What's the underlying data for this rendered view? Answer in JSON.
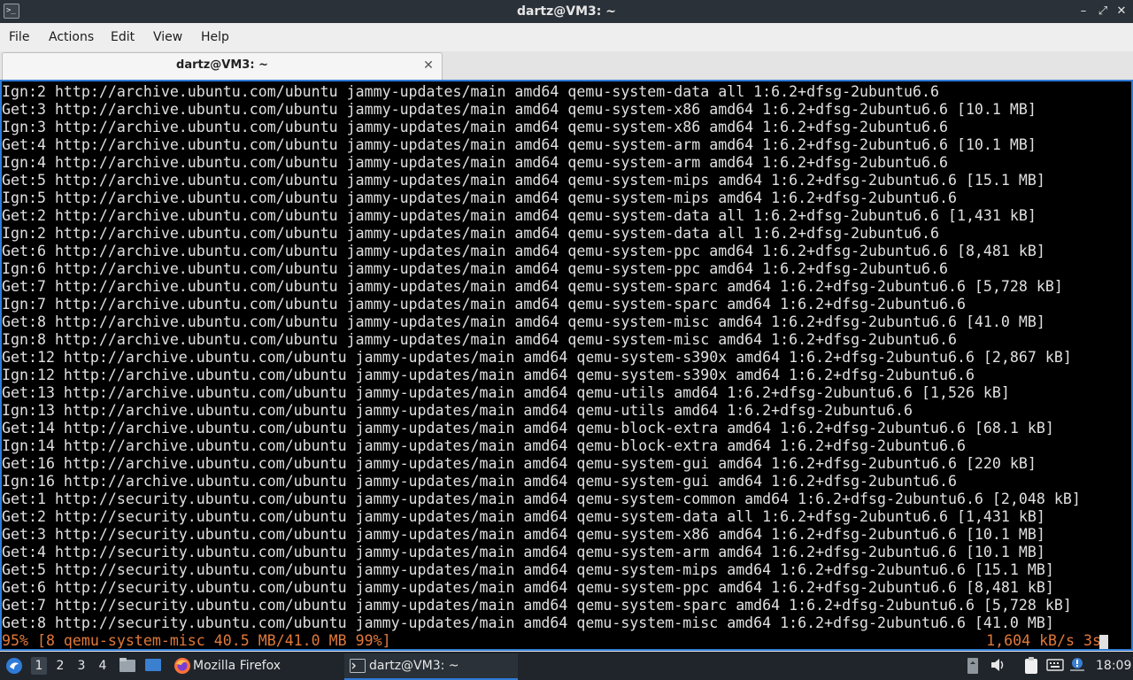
{
  "window": {
    "title": "dartz@VM3: ~",
    "app_icon_glyph": ">_",
    "controls": {
      "minimize": "–",
      "maximize": "⤢",
      "close": "✕"
    }
  },
  "menu": {
    "items": [
      "File",
      "Actions",
      "Edit",
      "View",
      "Help"
    ]
  },
  "tab": {
    "label": "dartz@VM3: ~",
    "close_glyph": "✕"
  },
  "terminal": {
    "lines": [
      "Ign:2 http://archive.ubuntu.com/ubuntu jammy-updates/main amd64 qemu-system-data all 1:6.2+dfsg-2ubuntu6.6",
      "Get:3 http://archive.ubuntu.com/ubuntu jammy-updates/main amd64 qemu-system-x86 amd64 1:6.2+dfsg-2ubuntu6.6 [10.1 MB]",
      "Ign:3 http://archive.ubuntu.com/ubuntu jammy-updates/main amd64 qemu-system-x86 amd64 1:6.2+dfsg-2ubuntu6.6",
      "Get:4 http://archive.ubuntu.com/ubuntu jammy-updates/main amd64 qemu-system-arm amd64 1:6.2+dfsg-2ubuntu6.6 [10.1 MB]",
      "Ign:4 http://archive.ubuntu.com/ubuntu jammy-updates/main amd64 qemu-system-arm amd64 1:6.2+dfsg-2ubuntu6.6",
      "Get:5 http://archive.ubuntu.com/ubuntu jammy-updates/main amd64 qemu-system-mips amd64 1:6.2+dfsg-2ubuntu6.6 [15.1 MB]",
      "Ign:5 http://archive.ubuntu.com/ubuntu jammy-updates/main amd64 qemu-system-mips amd64 1:6.2+dfsg-2ubuntu6.6",
      "Get:2 http://archive.ubuntu.com/ubuntu jammy-updates/main amd64 qemu-system-data all 1:6.2+dfsg-2ubuntu6.6 [1,431 kB]",
      "Ign:2 http://archive.ubuntu.com/ubuntu jammy-updates/main amd64 qemu-system-data all 1:6.2+dfsg-2ubuntu6.6",
      "Get:6 http://archive.ubuntu.com/ubuntu jammy-updates/main amd64 qemu-system-ppc amd64 1:6.2+dfsg-2ubuntu6.6 [8,481 kB]",
      "Ign:6 http://archive.ubuntu.com/ubuntu jammy-updates/main amd64 qemu-system-ppc amd64 1:6.2+dfsg-2ubuntu6.6",
      "Get:7 http://archive.ubuntu.com/ubuntu jammy-updates/main amd64 qemu-system-sparc amd64 1:6.2+dfsg-2ubuntu6.6 [5,728 kB]",
      "Ign:7 http://archive.ubuntu.com/ubuntu jammy-updates/main amd64 qemu-system-sparc amd64 1:6.2+dfsg-2ubuntu6.6",
      "Get:8 http://archive.ubuntu.com/ubuntu jammy-updates/main amd64 qemu-system-misc amd64 1:6.2+dfsg-2ubuntu6.6 [41.0 MB]",
      "Ign:8 http://archive.ubuntu.com/ubuntu jammy-updates/main amd64 qemu-system-misc amd64 1:6.2+dfsg-2ubuntu6.6",
      "Get:12 http://archive.ubuntu.com/ubuntu jammy-updates/main amd64 qemu-system-s390x amd64 1:6.2+dfsg-2ubuntu6.6 [2,867 kB]",
      "Ign:12 http://archive.ubuntu.com/ubuntu jammy-updates/main amd64 qemu-system-s390x amd64 1:6.2+dfsg-2ubuntu6.6",
      "Get:13 http://archive.ubuntu.com/ubuntu jammy-updates/main amd64 qemu-utils amd64 1:6.2+dfsg-2ubuntu6.6 [1,526 kB]",
      "Ign:13 http://archive.ubuntu.com/ubuntu jammy-updates/main amd64 qemu-utils amd64 1:6.2+dfsg-2ubuntu6.6",
      "Get:14 http://archive.ubuntu.com/ubuntu jammy-updates/main amd64 qemu-block-extra amd64 1:6.2+dfsg-2ubuntu6.6 [68.1 kB]",
      "Ign:14 http://archive.ubuntu.com/ubuntu jammy-updates/main amd64 qemu-block-extra amd64 1:6.2+dfsg-2ubuntu6.6",
      "Get:16 http://archive.ubuntu.com/ubuntu jammy-updates/main amd64 qemu-system-gui amd64 1:6.2+dfsg-2ubuntu6.6 [220 kB]",
      "Ign:16 http://archive.ubuntu.com/ubuntu jammy-updates/main amd64 qemu-system-gui amd64 1:6.2+dfsg-2ubuntu6.6",
      "Get:1 http://security.ubuntu.com/ubuntu jammy-updates/main amd64 qemu-system-common amd64 1:6.2+dfsg-2ubuntu6.6 [2,048 kB]",
      "Get:2 http://security.ubuntu.com/ubuntu jammy-updates/main amd64 qemu-system-data all 1:6.2+dfsg-2ubuntu6.6 [1,431 kB]",
      "Get:3 http://security.ubuntu.com/ubuntu jammy-updates/main amd64 qemu-system-x86 amd64 1:6.2+dfsg-2ubuntu6.6 [10.1 MB]",
      "Get:4 http://security.ubuntu.com/ubuntu jammy-updates/main amd64 qemu-system-arm amd64 1:6.2+dfsg-2ubuntu6.6 [10.1 MB]",
      "Get:5 http://security.ubuntu.com/ubuntu jammy-updates/main amd64 qemu-system-mips amd64 1:6.2+dfsg-2ubuntu6.6 [15.1 MB]",
      "Get:6 http://security.ubuntu.com/ubuntu jammy-updates/main amd64 qemu-system-ppc amd64 1:6.2+dfsg-2ubuntu6.6 [8,481 kB]",
      "Get:7 http://security.ubuntu.com/ubuntu jammy-updates/main amd64 qemu-system-sparc amd64 1:6.2+dfsg-2ubuntu6.6 [5,728 kB]",
      "Get:8 http://security.ubuntu.com/ubuntu jammy-updates/main amd64 qemu-system-misc amd64 1:6.2+dfsg-2ubuntu6.6 [41.0 MB]"
    ],
    "progress_left": "95% [8 qemu-system-misc 40.5 MB/41.0 MB 99%]",
    "progress_right": "1,604 kB/s 3s",
    "colors": {
      "background": "#000000",
      "text": "#e0e0e0",
      "progress": "#e0783a",
      "focus_border": "#2f7bd7"
    }
  },
  "taskbar": {
    "start_icon": "menu-icon",
    "desktops": [
      "1",
      "2",
      "3",
      "4"
    ],
    "active_desktop": "1",
    "tasks": [
      {
        "label": "Mozilla Firefox",
        "icon": "firefox-icon"
      },
      {
        "label": "dartz@VM3: ~",
        "icon": "terminal-icon"
      }
    ],
    "tray_icons": [
      "storage-icon",
      "volume-icon",
      "clipboard-icon",
      "keyboard-icon",
      "notification-icon"
    ],
    "clock": "18:09"
  }
}
